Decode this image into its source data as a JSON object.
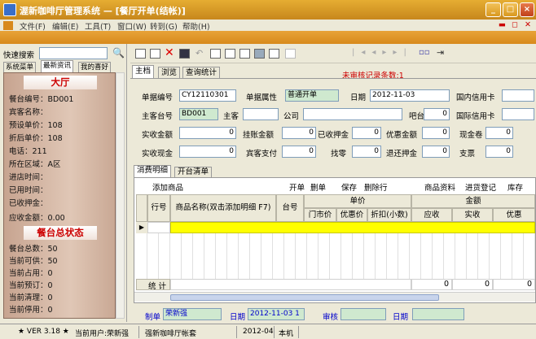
{
  "window": {
    "title": "渥新咖啡厅管理系统 — [餐厅开单(结帐)]"
  },
  "menu": [
    "文件(F)",
    "编辑(E)",
    "工具(T)",
    "窗口(W)",
    "转到(G)",
    "帮助(H)"
  ],
  "left": {
    "search_label": "快速搜索",
    "tabs": [
      "系统菜单",
      "最新资讯",
      "我的喜好"
    ],
    "hall_title": "大厅",
    "hall_rows": [
      "餐台编号：BD001",
      "宾客名称：",
      "预设单价：108",
      "折后单价：108",
      "电话：211",
      "所在区域：A区",
      "进店时间：",
      "已用时间：",
      "已收押金：",
      "应收金额：0.00"
    ],
    "status_title": "餐台总状态",
    "status_rows": [
      "餐台总数：50",
      "当前可供：50",
      "当前占用：0",
      "当前预订：0",
      "当前清理：0",
      "当前停用：0"
    ]
  },
  "main_tabs": [
    "主档",
    "浏览",
    "查询统计"
  ],
  "unaudited": "未审核记录条数:1",
  "form": {
    "doc_no_label": "单据编号",
    "doc_no": "CY12110301",
    "doc_attr_label": "单据属性",
    "doc_attr": "普通开单",
    "date_label": "日期",
    "date": "2012-11-03",
    "dom_card_label": "国内信用卡",
    "table_no_label": "主客台号",
    "table_no": "BD001",
    "host_label": "主客",
    "company_label": "公司",
    "bar_label": "吧台消费",
    "bar_val": "0",
    "intl_card_label": "国际信用卡",
    "recv_amt_label": "实收金额",
    "recv_amt": "0",
    "hang_label": "挂账金额",
    "hang_val": "0",
    "deposit_label": "已收押金",
    "deposit_val": "0",
    "discount_label": "优惠金额",
    "discount_val": "0",
    "cash_coupon_label": "现金卷",
    "cash_coupon_val": "0",
    "cash_label": "实收现金",
    "cash_val": "0",
    "guest_pay_label": "宾客支付",
    "guest_pay_val": "0",
    "change_label": "找零",
    "change_val": "0",
    "refund_label": "退还押金",
    "refund_val": "0",
    "cheque_label": "支票",
    "cheque_val": "0"
  },
  "bottom_tabs": [
    "消费明细",
    "开台清单"
  ],
  "grid_toolbar": {
    "add": "添加商品",
    "open": "开单",
    "del": "删单",
    "save": "保存",
    "delrow": "删除行",
    "goods": "商品资料",
    "purchase": "进货登记",
    "stock": "库存"
  },
  "grid_headers": {
    "row": "行号",
    "name": "商品名称(双击添加明细 F7)",
    "table": "台号",
    "price": "单价",
    "store_price": "门市价",
    "disc_price": "优惠价",
    "discount": "折扣(小数)",
    "amount": "金额",
    "receivable": "应收",
    "received": "实收",
    "favor": "优惠"
  },
  "grid_total": {
    "label": "统 计",
    "receivable": "0",
    "received": "0",
    "favor": "0"
  },
  "footer": {
    "maker_label": "制单",
    "maker": "荣新强",
    "date_label": "日期",
    "date": "2012-11-03 1",
    "audit_label": "审核",
    "date2_label": "日期"
  },
  "statusbar": {
    "version": "★ VER 3.18 ★",
    "user": "当前用户:荣新强",
    "company": "强新咖啡厅帐套",
    "period": "2012-04",
    "machine": "本机"
  },
  "colors": {
    "accent": "#d88a1c",
    "red": "#cc0000",
    "highlight": "#ffff00"
  }
}
